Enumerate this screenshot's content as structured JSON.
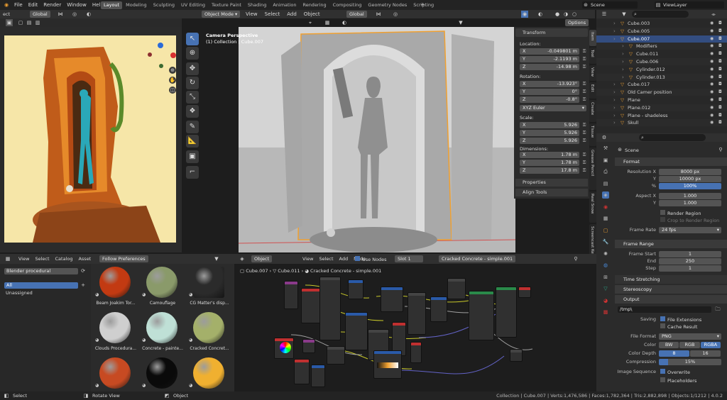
{
  "colors": {
    "accent": "#4772b3",
    "orange": "#f0a030",
    "header": "#303030",
    "bg": "#1d1d1d"
  },
  "topbar": {
    "menus": [
      "File",
      "Edit",
      "Render",
      "Window",
      "Help"
    ],
    "workspaces": [
      "Layout",
      "Modeling",
      "Sculpting",
      "UV Editing",
      "Texture Paint",
      "Shading",
      "Animation",
      "Rendering",
      "Compositing",
      "Geometry Nodes",
      "Scripting"
    ],
    "add_tab": "+",
    "scene_label": "Scene",
    "viewlayer_label": "ViewLayer"
  },
  "left_view": {
    "orientation": "Global"
  },
  "viewport": {
    "mode": "Object Mode",
    "menus": [
      "View",
      "Select",
      "Add",
      "Object"
    ],
    "orientation": "Global",
    "options": "Options",
    "camera_title": "Camera Perspective",
    "collection_line": "(1) Collection | Cube.007"
  },
  "npanel": {
    "header": "Transform",
    "location_label": "Location:",
    "location": [
      {
        "a": "X",
        "v": "-0.049801 m"
      },
      {
        "a": "Y",
        "v": "-2.1193 m"
      },
      {
        "a": "Z",
        "v": "-14.98 m"
      }
    ],
    "rotation_label": "Rotation:",
    "rotation": [
      {
        "a": "X",
        "v": "-13.923°"
      },
      {
        "a": "Y",
        "v": "0°"
      },
      {
        "a": "Z",
        "v": "-0.8°"
      }
    ],
    "euler": "XYZ Euler",
    "scale_label": "Scale:",
    "scale": [
      {
        "a": "X",
        "v": "5.926"
      },
      {
        "a": "Y",
        "v": "5.926"
      },
      {
        "a": "Z",
        "v": "5.926"
      }
    ],
    "dims_label": "Dimensions:",
    "dims": [
      {
        "a": "X",
        "v": "1.78 m"
      },
      {
        "a": "Y",
        "v": "1.78 m"
      },
      {
        "a": "Z",
        "v": "17.8 m"
      }
    ],
    "properties": "Properties",
    "align_tools": "Align Tools",
    "tabs": [
      "Item",
      "Tool",
      "View",
      "Edit",
      "Create",
      "Tissue",
      "Grease Pencil",
      "Real Snow",
      "Screencast Keys"
    ]
  },
  "outliner": {
    "items": [
      {
        "name": "Cube.003",
        "indent": 1,
        "sel": false
      },
      {
        "name": "Cube.005",
        "indent": 1,
        "sel": false
      },
      {
        "name": "Cube.007",
        "indent": 1,
        "sel": true
      },
      {
        "name": "Modifiers",
        "indent": 2,
        "sel": false
      },
      {
        "name": "Cube.011",
        "indent": 2,
        "sel": false
      },
      {
        "name": "Cube.006",
        "indent": 2,
        "sel": false
      },
      {
        "name": "Cylinder.012",
        "indent": 2,
        "sel": false
      },
      {
        "name": "Cylinder.013",
        "indent": 2,
        "sel": false
      },
      {
        "name": "Cube.017",
        "indent": 1,
        "sel": false
      },
      {
        "name": "Old Camer position",
        "indent": 1,
        "sel": false
      },
      {
        "name": "Plane",
        "indent": 1,
        "sel": false
      },
      {
        "name": "Plane.012",
        "indent": 1,
        "sel": false
      },
      {
        "name": "Plane - shadeless",
        "indent": 1,
        "sel": false
      },
      {
        "name": "Skull",
        "indent": 1,
        "sel": false
      }
    ]
  },
  "props": {
    "breadcrumb": "Scene",
    "format": "Format",
    "res_x_label": "Resolution X",
    "res_x": "8000 px",
    "y_label": "Y",
    "res_y": "10000 px",
    "pct_label": "%",
    "pct": "100%",
    "aspect_label": "Aspect X",
    "aspect_x": "1.000",
    "aspect_y": "1.000",
    "render_region": "Render Region",
    "crop": "Crop to Render Region",
    "fps_label": "Frame Rate",
    "fps": "24 fps",
    "frame_range": "Frame Range",
    "fstart_label": "Frame Start",
    "fstart": "1",
    "fend_label": "End",
    "fend": "250",
    "fstep_label": "Step",
    "fstep": "1",
    "time_stretching": "Time Stretching",
    "stereoscopy": "Stereoscopy",
    "output": "Output",
    "path": "/tmp\\",
    "saving_label": "Saving",
    "file_ext": "File Extensions",
    "cache": "Cache Result",
    "ff_label": "File Format",
    "ff": "PNG",
    "color_label": "Color",
    "color_opts": [
      "BW",
      "RGB",
      "RGBA"
    ],
    "depth_label": "Color Depth",
    "depth_opts": [
      "8",
      "16"
    ],
    "comp_label": "Compression",
    "comp": "15%",
    "imgseq_label": "Image Sequence",
    "overwrite": "Overwrite",
    "placeholders": "Placeholders"
  },
  "asset": {
    "menus": [
      "View",
      "Select",
      "Catalog",
      "Asset"
    ],
    "follow": "Follow Preferences",
    "library": "Blender procedural",
    "all": "All",
    "unassigned": "Unassigned",
    "items": [
      {
        "name": "Beam Joakim Tor...",
        "color": "#c23a12"
      },
      {
        "name": "Camouflage",
        "color": "#8a9a6a"
      },
      {
        "name": "CG Matter's disp...",
        "color": "#2b2b2b"
      },
      {
        "name": "Clouds Procedura...",
        "color": "#cfcfcf"
      },
      {
        "name": "Concrete - painte...",
        "color": "#bfe0d6"
      },
      {
        "name": "Cracked Concret...",
        "color": "#a4b06a"
      },
      {
        "name": "",
        "color": "#c74a22"
      },
      {
        "name": "",
        "color": "#0a0a0a"
      },
      {
        "name": "",
        "color": "#f0b030"
      }
    ]
  },
  "node_editor": {
    "object": "Object",
    "menus": [
      "View",
      "Select",
      "Add",
      "Node"
    ],
    "use_nodes": "Use Nodes",
    "slot": "Slot 1",
    "material": "Cracked Concrete - simple.001",
    "breadcrumb": [
      "Cube.007",
      "Cube.011",
      "Cracked Concrete - simple.001"
    ]
  },
  "status": {
    "left": [
      "Select",
      "Rotate View",
      "Object"
    ],
    "right": "Collection | Cube.007 | Verts:1,476,586 | Faces:1,782,364 | Tris:2,882,898 | Objects:1/1212 | 4.0.2"
  }
}
